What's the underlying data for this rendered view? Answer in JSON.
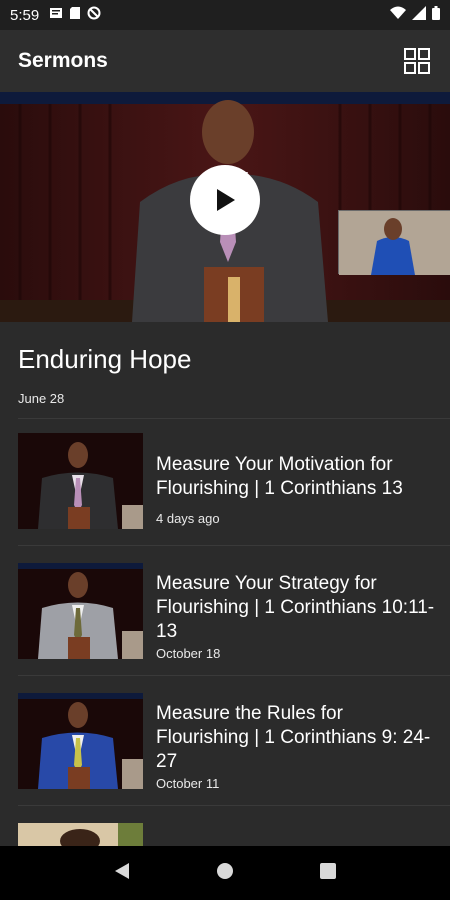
{
  "status": {
    "time": "5:59",
    "left_icons": [
      "sim-icon",
      "storage-icon",
      "blocked-icon"
    ],
    "right_icons": [
      "wifi-icon",
      "signal-icon",
      "battery-icon"
    ]
  },
  "app_bar": {
    "title": "Sermons",
    "view_toggle_icon": "grid-icon"
  },
  "featured": {
    "title": "Enduring Hope",
    "date": "June 28",
    "play_icon": "play-icon"
  },
  "sermons": [
    {
      "title": "Measure Your Motivation for Flourishing | 1 Corinthians 13",
      "date": "4 days ago"
    },
    {
      "title": "Measure Your Strategy for Flourishing | 1 Corinthians 10:11-13",
      "date": "October 18"
    },
    {
      "title": "Measure the Rules for Flourishing | 1 Corinthians 9: 24-27",
      "date": "October 11"
    }
  ],
  "nav": {
    "back_icon": "back-icon",
    "home_icon": "home-icon",
    "recents_icon": "recents-icon"
  }
}
